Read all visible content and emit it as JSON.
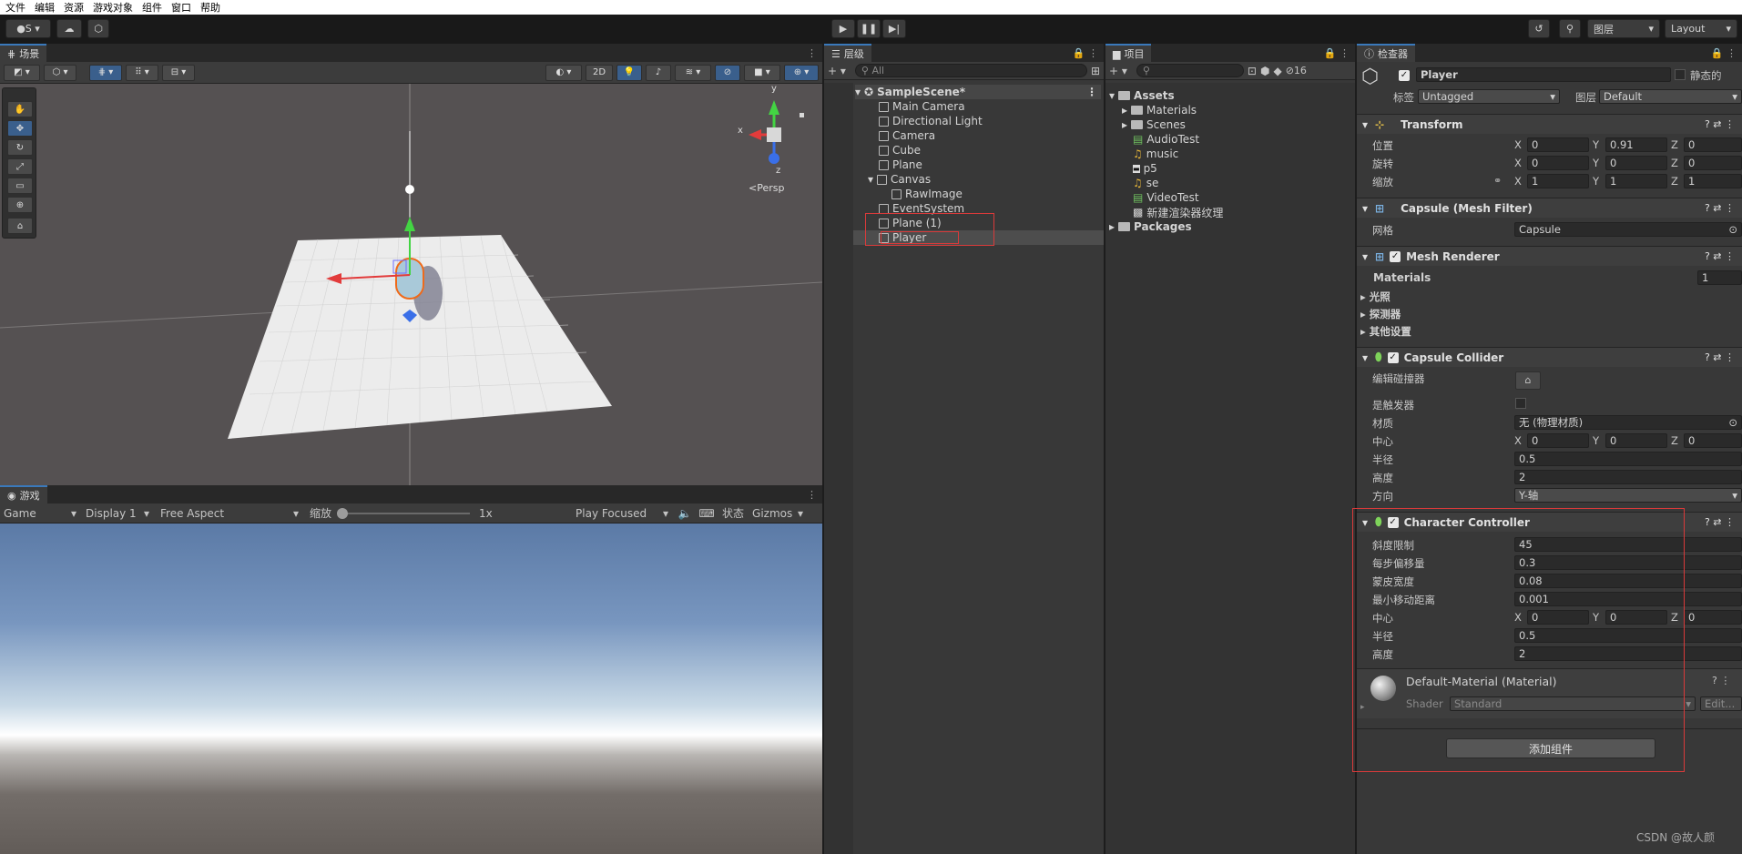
{
  "menu": [
    "文件",
    "编辑",
    "资源",
    "游戏对象",
    "组件",
    "窗口",
    "帮助"
  ],
  "toolbar": {
    "account": "S",
    "layers_label": "图层",
    "layout_label": "Layout"
  },
  "scene": {
    "tab": "场景",
    "btn_2d": "2D",
    "persp": "<Persp",
    "axes": {
      "x": "x",
      "y": "y",
      "z": "z"
    }
  },
  "game": {
    "tab": "游戏",
    "mode": "Game",
    "display": "Display 1",
    "aspect": "Free Aspect",
    "scale_label": "缩放",
    "scale_value": "1x",
    "play_mode": "Play Focused",
    "stats": "状态",
    "gizmos": "Gizmos"
  },
  "hierarchy": {
    "tab": "层级",
    "search_placeholder": "All",
    "scene": "SampleScene*",
    "items": [
      "Main Camera",
      "Directional Light",
      "Camera",
      "Cube",
      "Plane",
      "Canvas",
      "RawImage",
      "EventSystem",
      "Plane (1)",
      "Player"
    ]
  },
  "project": {
    "tab": "项目",
    "hidden_count": "16",
    "assets_root": "Assets",
    "assets": [
      "Materials",
      "Scenes",
      "AudioTest",
      "music",
      "p5",
      "se",
      "VideoTest",
      "新建渲染器纹理"
    ],
    "packages": "Packages"
  },
  "inspector": {
    "tab": "检查器",
    "object_name": "Player",
    "static_label": "静态的",
    "tag_label": "标签",
    "tag_value": "Untagged",
    "layer_label": "图层",
    "layer_value": "Default",
    "transform": {
      "title": "Transform",
      "pos_label": "位置",
      "pos": {
        "x": "0",
        "y": "0.91",
        "z": "0"
      },
      "rot_label": "旋转",
      "rot": {
        "x": "0",
        "y": "0",
        "z": "0"
      },
      "scale_label": "缩放",
      "scale": {
        "x": "1",
        "y": "1",
        "z": "1"
      }
    },
    "mesh_filter": {
      "title": "Capsule (Mesh Filter)",
      "mesh_label": "网格",
      "mesh_value": "Capsule"
    },
    "mesh_renderer": {
      "title": "Mesh Renderer",
      "materials_label": "Materials",
      "materials_count": "1",
      "lighting": "光照",
      "probes": "探测器",
      "other": "其他设置"
    },
    "capsule_collider": {
      "title": "Capsule Collider",
      "edit_label": "编辑碰撞器",
      "trigger_label": "是触发器",
      "material_label": "材质",
      "material_value": "无 (物理材质)",
      "center_label": "中心",
      "center": {
        "x": "0",
        "y": "0",
        "z": "0"
      },
      "radius_label": "半径",
      "radius": "0.5",
      "height_label": "高度",
      "height": "2",
      "direction_label": "方向",
      "direction": "Y-轴"
    },
    "character_controller": {
      "title": "Character Controller",
      "slope_label": "斜度限制",
      "slope": "45",
      "step_label": "每步偏移量",
      "step": "0.3",
      "skin_label": "蒙皮宽度",
      "skin": "0.08",
      "min_move_label": "最小移动距离",
      "min_move": "0.001",
      "center_label": "中心",
      "center": {
        "x": "0",
        "y": "0",
        "z": "0"
      },
      "radius_label": "半径",
      "radius": "0.5",
      "height_label": "高度",
      "height": "2"
    },
    "material": {
      "title": "Default-Material (Material)",
      "shader_label": "Shader",
      "shader_value": "Standard",
      "edit": "Edit..."
    },
    "add_component": "添加组件"
  },
  "watermark": "CSDN @故人颜",
  "colors": {
    "accent": "#3a79bb",
    "highlight": "#d93a3a",
    "bg": "#383838"
  }
}
